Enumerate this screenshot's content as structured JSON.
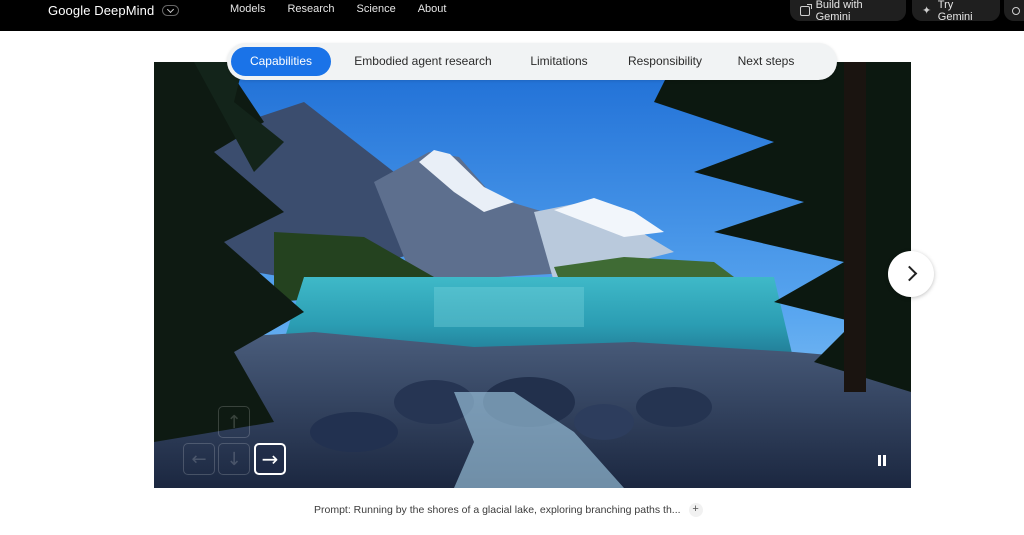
{
  "nav": {
    "brand": "Google DeepMind",
    "links": [
      "Models",
      "Research",
      "Science",
      "About"
    ],
    "build_label": "Build with Gemini",
    "try_label": "Try Gemini"
  },
  "tabs": [
    {
      "label": "Capabilities",
      "active": true
    },
    {
      "label": "Embodied agent research",
      "active": false
    },
    {
      "label": "Limitations",
      "active": false
    },
    {
      "label": "Responsibility",
      "active": false
    },
    {
      "label": "Next steps",
      "active": false
    }
  ],
  "media": {
    "keys": {
      "up": "↑",
      "left": "←",
      "down": "↓",
      "right": "→"
    },
    "active_key": "right"
  },
  "caption": {
    "text": "Prompt: Running by the shores of a glacial lake, exploring branching paths th...",
    "expand": "+"
  },
  "colors": {
    "accent": "#1a73e8",
    "nav_bg": "#000000"
  }
}
